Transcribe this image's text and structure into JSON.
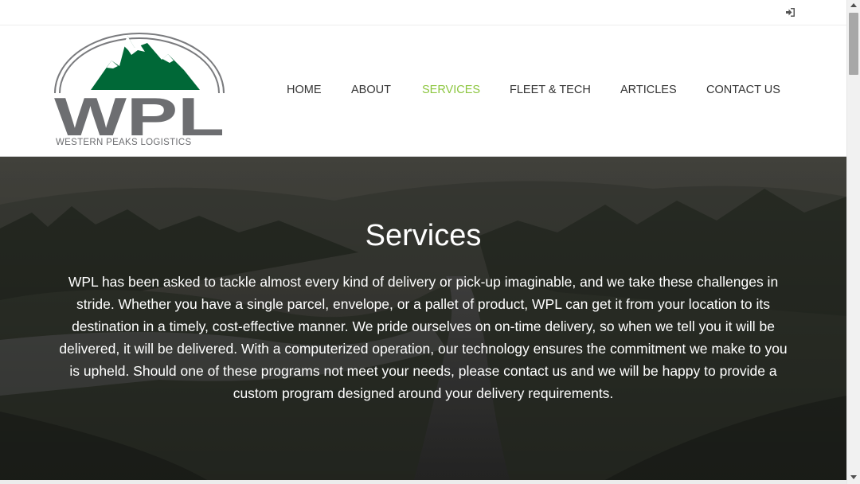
{
  "header": {
    "login_icon": "sign-in-icon",
    "logo": {
      "text": "WPL",
      "tagline": "WESTERN PEAKS LOGISTICS",
      "mountain_color": "#006837",
      "text_color": "#6d6e71"
    }
  },
  "nav": {
    "items": [
      {
        "label": "HOME"
      },
      {
        "label": "ABOUT"
      },
      {
        "label": "SERVICES",
        "active": true
      },
      {
        "label": "FLEET & TECH"
      },
      {
        "label": "ARTICLES"
      },
      {
        "label": "CONTACT US"
      }
    ],
    "active_color": "#8cc63f"
  },
  "hero": {
    "title": "Services",
    "text": "WPL has been asked to tackle almost every kind of delivery or pick-up imaginable, and we take these challenges in stride. Whether you have a single parcel, envelope, or a pallet of product, WPL can get it from your location to its destination in a timely, cost-effective manner. We pride ourselves on on-time delivery, so when we tell you it will be delivered, it will be delivered. With a computerized operation, our technology ensures the commitment we make to you is upheld. Should one of these programs not meet your needs, please contact us and we will be happy to provide a custom program designed around your delivery requirements."
  }
}
